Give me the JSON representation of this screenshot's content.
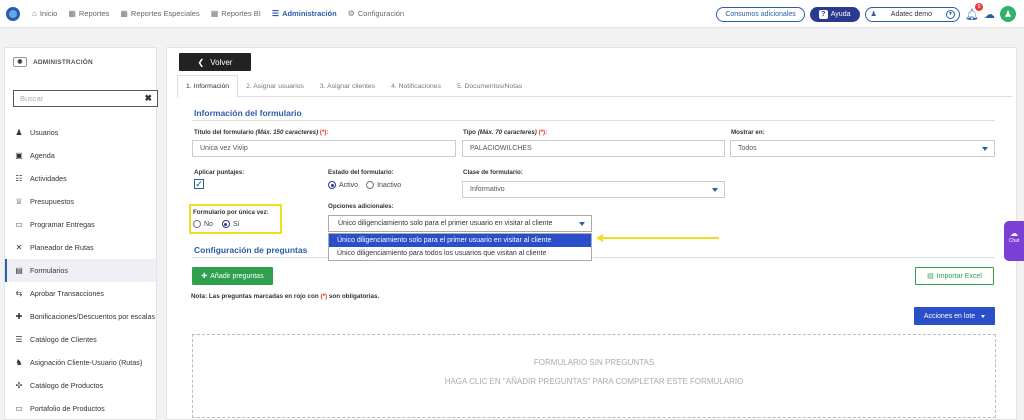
{
  "nav": {
    "items": [
      {
        "icon": "home-icon",
        "glyph": "⌂",
        "label": "Inicio"
      },
      {
        "icon": "grid-icon",
        "glyph": "▦",
        "label": "Reportes"
      },
      {
        "icon": "grid-icon",
        "glyph": "▦",
        "label": "Reportes Especiales"
      },
      {
        "icon": "grid-icon",
        "glyph": "▦",
        "label": "Reportes BI"
      },
      {
        "icon": "sliders-icon",
        "glyph": "☰",
        "label": "Administración"
      },
      {
        "icon": "gear-icon",
        "glyph": "⚙",
        "label": "Configuración"
      }
    ],
    "consumos": "Consumos adicionales",
    "help": "Ayuda",
    "user": "Adatec demo",
    "notif_count": "9"
  },
  "sidebar": {
    "title": "ADMINISTRACIÓN",
    "search_placeholder": "Buscar",
    "items": [
      {
        "label": "Usuarios",
        "glyph": "♟"
      },
      {
        "label": "Agenda",
        "glyph": "▣"
      },
      {
        "label": "Actividades",
        "glyph": "☷"
      },
      {
        "label": "Presupuestos",
        "glyph": "♕"
      },
      {
        "label": "Programar Entregas",
        "glyph": "▭"
      },
      {
        "label": "Planeador de Rutas",
        "glyph": "✕"
      },
      {
        "label": "Formularios",
        "glyph": "▤"
      },
      {
        "label": "Aprobar Transacciones",
        "glyph": "⇆"
      },
      {
        "label": "Bonificaciones/Descuentos por escalas",
        "glyph": "✚"
      },
      {
        "label": "Catálogo de Clientes",
        "glyph": "☰"
      },
      {
        "label": "Asignación Cliente-Usuario (Rutas)",
        "glyph": "♞"
      },
      {
        "label": "Catálogo de Productos",
        "glyph": "✣"
      },
      {
        "label": "Portafolio de Productos",
        "glyph": "▭"
      }
    ]
  },
  "main": {
    "back": "Volver",
    "tabs": [
      "1. Información",
      "2. Asignar usuarios",
      "3. Asignar clientes",
      "4. Notificaciones",
      "5. Documentos/Notas"
    ],
    "section_info": "Información del formulario",
    "title_label": "Título del formulario",
    "title_hint": "(Máx. 150 caracteres)",
    "title_req": "(*):",
    "title_value": "Unica vez Vivip",
    "type_label": "Tipo",
    "type_hint": "(Máx. 70 caracteres)",
    "type_req": "(*):",
    "type_value": "PALACIOWILCHES",
    "show_label": "Mostrar en:",
    "show_value": "Todos",
    "score_label": "Aplicar puntajes:",
    "state_label": "Estado del formulario:",
    "state_active": "Activo",
    "state_inactive": "Inactivo",
    "class_label": "Clase de formulario:",
    "class_value": "Informativo",
    "once_label": "Formulario por única vez:",
    "once_no": "No",
    "once_yes": "Sí",
    "extra_label": "Opciones adicionales:",
    "extra_value": "Único diligenciamiento solo para el primer usuario en visitar al cliente",
    "extra_options": [
      "Único diligenciamiento solo para el primer usuario en visitar al cliente",
      "Único diligenciamiento para todos los usuarios que visitan al cliente"
    ],
    "section_questions": "Configuración de preguntas",
    "add_questions": "Añadir preguntas",
    "import_excel": "Importar Excel",
    "note_prefix": "Nota: Las preguntas marcadas en rojo con ",
    "note_req": "(*)",
    "note_suffix": " son obligatorias.",
    "batch_actions": "Acciones en lote",
    "empty_title": "FORMULARIO SIN PREGUNTAS",
    "empty_hint": "HAGA CLIC EN \"AÑADIR PREGUNTAS\" PARA COMPLETAR ESTE FORMULARIO"
  },
  "chat_label": "Chat",
  "colors": {
    "accent": "#2b5cab",
    "green": "#2fa050",
    "highlight": "#f0dc20",
    "chat": "#7b3fd6"
  }
}
